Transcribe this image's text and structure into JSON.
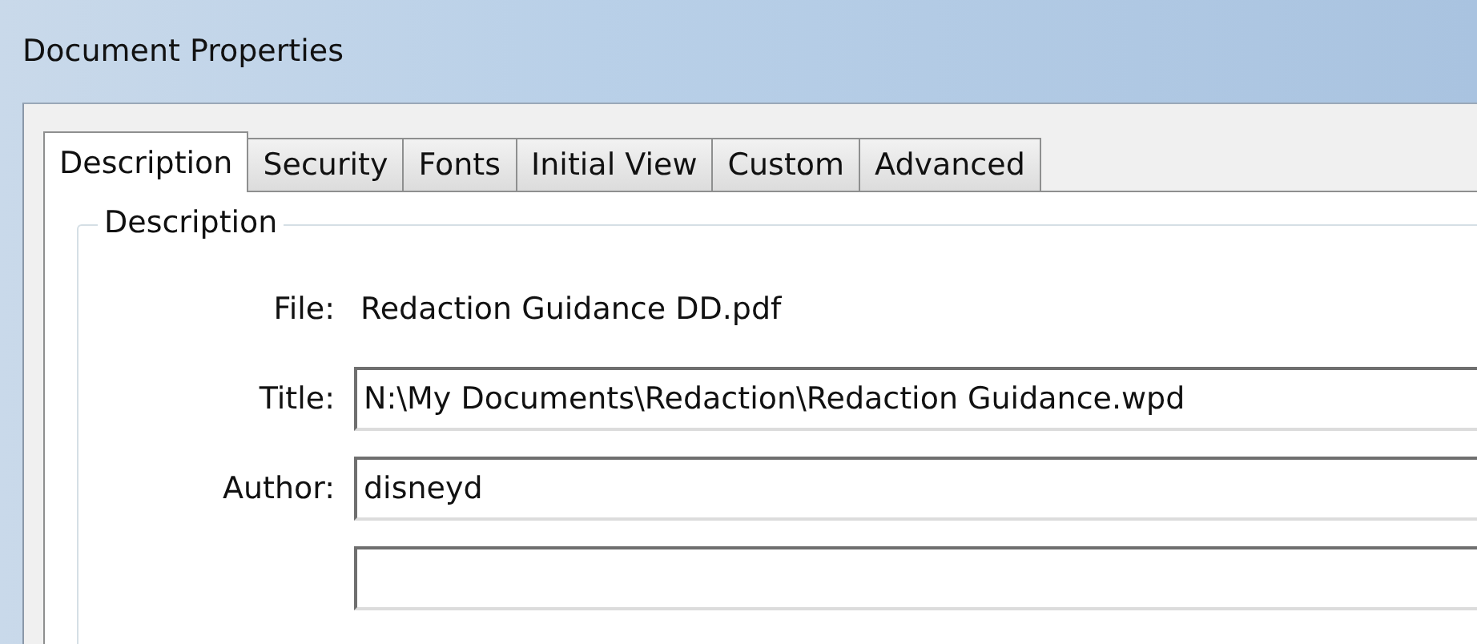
{
  "window": {
    "title": "Document Properties"
  },
  "tabs": [
    {
      "label": "Description",
      "selected": true
    },
    {
      "label": "Security",
      "selected": false
    },
    {
      "label": "Fonts",
      "selected": false
    },
    {
      "label": "Initial View",
      "selected": false
    },
    {
      "label": "Custom",
      "selected": false
    },
    {
      "label": "Advanced",
      "selected": false
    }
  ],
  "group": {
    "title": "Description"
  },
  "fields": [
    {
      "label": "File:",
      "kind": "static",
      "value": "Redaction Guidance DD.pdf"
    },
    {
      "label": "Title:",
      "kind": "input",
      "value": "N:\\My Documents\\Redaction\\Redaction Guidance.wpd"
    },
    {
      "label": "Author:",
      "kind": "input",
      "value": "disneyd"
    },
    {
      "kind": "input-cut"
    }
  ]
}
